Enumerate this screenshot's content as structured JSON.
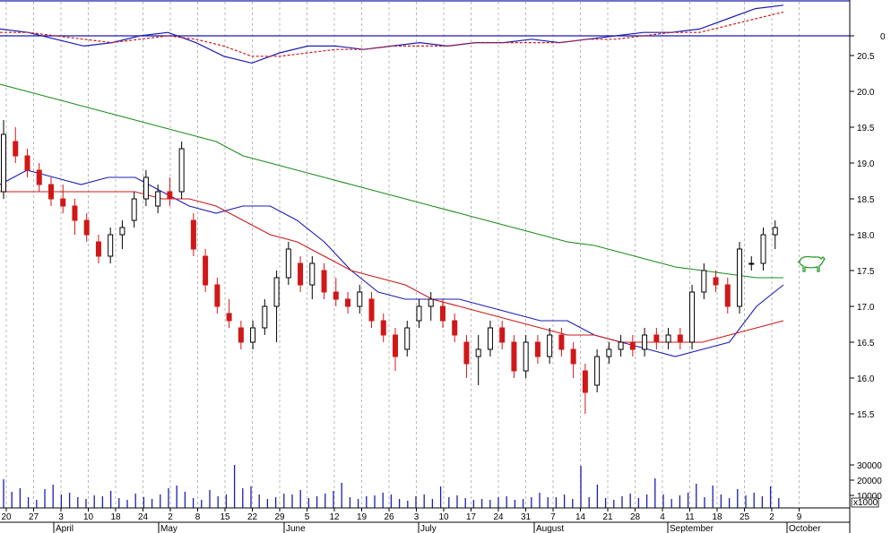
{
  "chart_data": {
    "type": "candlestick",
    "title": "",
    "price_axis": {
      "ticks": [
        "15.5",
        "16.0",
        "16.5",
        "17.0",
        "17.5",
        "18.0",
        "18.5",
        "19.0",
        "19.5",
        "20.0",
        "20.5"
      ],
      "ylim": [
        15.0,
        21.0
      ]
    },
    "oscillator_axis": {
      "ticks": [
        "0"
      ]
    },
    "volume_axis": {
      "ticks": [
        "30000",
        "20000",
        "10000"
      ],
      "unit_label": "x1000"
    },
    "x_ticks": [
      "20",
      "27",
      "3",
      "10",
      "18",
      "24",
      "2",
      "8",
      "15",
      "22",
      "29",
      "5",
      "12",
      "19",
      "26",
      "3",
      "10",
      "17",
      "24",
      "31",
      "7",
      "14",
      "21",
      "28",
      "4",
      "11",
      "18",
      "25",
      "2",
      "9"
    ],
    "months": [
      "April",
      "May",
      "June",
      "July",
      "August",
      "September",
      "October"
    ],
    "series": [
      {
        "name": "",
        "kind": "sma_short",
        "color": "#1c1cb4",
        "values": [
          18.7,
          18.9,
          18.8,
          18.7,
          18.8,
          18.8,
          18.6,
          18.4,
          18.3,
          18.4,
          18.4,
          18.2,
          17.9,
          17.5,
          17.2,
          17.1,
          17.1,
          17.1,
          17.0,
          16.9,
          16.8,
          16.8,
          16.6,
          16.5,
          16.4,
          16.3,
          16.4,
          16.5,
          17.0,
          17.3
        ]
      },
      {
        "name": "",
        "kind": "sma_medium",
        "color": "#cc1a1a",
        "values": [
          18.6,
          18.6,
          18.6,
          18.6,
          18.6,
          18.6,
          18.5,
          18.5,
          18.4,
          18.2,
          18.0,
          17.9,
          17.7,
          17.5,
          17.4,
          17.3,
          17.1,
          17.0,
          16.9,
          16.8,
          16.7,
          16.6,
          16.6,
          16.5,
          16.5,
          16.5,
          16.5,
          16.6,
          16.7,
          16.8
        ]
      },
      {
        "name": "",
        "kind": "sma_long",
        "color": "#1e8c1e",
        "values": [
          20.1,
          20.0,
          19.9,
          19.8,
          19.7,
          19.6,
          19.5,
          19.4,
          19.3,
          19.1,
          19.0,
          18.9,
          18.8,
          18.7,
          18.6,
          18.5,
          18.4,
          18.3,
          18.2,
          18.1,
          18.0,
          17.9,
          17.85,
          17.75,
          17.65,
          17.55,
          17.5,
          17.45,
          17.4,
          17.4
        ]
      }
    ],
    "oscillator_series": [
      {
        "name": "",
        "color": "#1c1cb4",
        "style": "solid",
        "values": [
          0.2,
          0.1,
          -0.1,
          -0.3,
          -0.2,
          0.0,
          0.1,
          -0.2,
          -0.6,
          -0.8,
          -0.5,
          -0.3,
          -0.3,
          -0.4,
          -0.3,
          -0.2,
          -0.3,
          -0.2,
          -0.2,
          -0.1,
          -0.2,
          -0.1,
          0.0,
          0.1,
          0.1,
          0.2,
          0.5,
          0.8,
          0.9
        ]
      },
      {
        "name": "",
        "color": "#cc1a1a",
        "style": "dashed",
        "values": [
          0.1,
          0.1,
          0.0,
          -0.1,
          -0.2,
          -0.1,
          0.0,
          -0.1,
          -0.3,
          -0.6,
          -0.6,
          -0.5,
          -0.4,
          -0.4,
          -0.3,
          -0.3,
          -0.3,
          -0.2,
          -0.2,
          -0.2,
          -0.2,
          -0.1,
          -0.1,
          0.0,
          0.1,
          0.1,
          0.3,
          0.5,
          0.7
        ]
      }
    ],
    "candles": [
      {
        "o": 18.6,
        "h": 19.6,
        "l": 18.5,
        "c": 19.4
      },
      {
        "o": 19.3,
        "h": 19.5,
        "l": 19.0,
        "c": 19.1
      },
      {
        "o": 19.1,
        "h": 19.2,
        "l": 18.8,
        "c": 18.9
      },
      {
        "o": 18.9,
        "h": 19.0,
        "l": 18.6,
        "c": 18.7
      },
      {
        "o": 18.7,
        "h": 18.8,
        "l": 18.4,
        "c": 18.5
      },
      {
        "o": 18.5,
        "h": 18.7,
        "l": 18.3,
        "c": 18.4
      },
      {
        "o": 18.4,
        "h": 18.5,
        "l": 18.0,
        "c": 18.2
      },
      {
        "o": 18.2,
        "h": 18.3,
        "l": 17.9,
        "c": 18.0
      },
      {
        "o": 17.9,
        "h": 18.0,
        "l": 17.6,
        "c": 17.7
      },
      {
        "o": 17.7,
        "h": 18.1,
        "l": 17.6,
        "c": 18.0
      },
      {
        "o": 18.0,
        "h": 18.2,
        "l": 17.8,
        "c": 18.1
      },
      {
        "o": 18.2,
        "h": 18.6,
        "l": 18.1,
        "c": 18.5
      },
      {
        "o": 18.5,
        "h": 18.9,
        "l": 18.4,
        "c": 18.8
      },
      {
        "o": 18.4,
        "h": 18.7,
        "l": 18.3,
        "c": 18.6
      },
      {
        "o": 18.6,
        "h": 18.8,
        "l": 18.4,
        "c": 18.5
      },
      {
        "o": 18.6,
        "h": 19.3,
        "l": 18.5,
        "c": 19.2
      },
      {
        "o": 18.2,
        "h": 18.3,
        "l": 17.7,
        "c": 17.8
      },
      {
        "o": 17.7,
        "h": 17.8,
        "l": 17.2,
        "c": 17.3
      },
      {
        "o": 17.3,
        "h": 17.4,
        "l": 16.9,
        "c": 17.0
      },
      {
        "o": 16.9,
        "h": 17.1,
        "l": 16.7,
        "c": 16.8
      },
      {
        "o": 16.7,
        "h": 16.8,
        "l": 16.4,
        "c": 16.5
      },
      {
        "o": 16.5,
        "h": 16.8,
        "l": 16.4,
        "c": 16.7
      },
      {
        "o": 16.7,
        "h": 17.1,
        "l": 16.6,
        "c": 17.0
      },
      {
        "o": 17.0,
        "h": 17.5,
        "l": 16.5,
        "c": 17.4
      },
      {
        "o": 17.4,
        "h": 17.9,
        "l": 17.3,
        "c": 17.8
      },
      {
        "o": 17.6,
        "h": 17.7,
        "l": 17.2,
        "c": 17.3
      },
      {
        "o": 17.3,
        "h": 17.7,
        "l": 17.1,
        "c": 17.6
      },
      {
        "o": 17.5,
        "h": 17.6,
        "l": 17.1,
        "c": 17.2
      },
      {
        "o": 17.2,
        "h": 17.4,
        "l": 17.0,
        "c": 17.1
      },
      {
        "o": 17.1,
        "h": 17.2,
        "l": 16.9,
        "c": 17.0
      },
      {
        "o": 17.0,
        "h": 17.3,
        "l": 16.9,
        "c": 17.2
      },
      {
        "o": 17.1,
        "h": 17.2,
        "l": 16.7,
        "c": 16.8
      },
      {
        "o": 16.8,
        "h": 16.9,
        "l": 16.5,
        "c": 16.6
      },
      {
        "o": 16.6,
        "h": 16.7,
        "l": 16.1,
        "c": 16.3
      },
      {
        "o": 16.4,
        "h": 16.8,
        "l": 16.3,
        "c": 16.7
      },
      {
        "o": 16.8,
        "h": 17.1,
        "l": 16.7,
        "c": 17.0
      },
      {
        "o": 17.0,
        "h": 17.2,
        "l": 16.8,
        "c": 17.1
      },
      {
        "o": 17.0,
        "h": 17.1,
        "l": 16.7,
        "c": 16.8
      },
      {
        "o": 16.8,
        "h": 16.9,
        "l": 16.5,
        "c": 16.6
      },
      {
        "o": 16.5,
        "h": 16.6,
        "l": 16.0,
        "c": 16.2
      },
      {
        "o": 16.3,
        "h": 16.6,
        "l": 15.9,
        "c": 16.4
      },
      {
        "o": 16.4,
        "h": 16.8,
        "l": 16.3,
        "c": 16.7
      },
      {
        "o": 16.7,
        "h": 16.8,
        "l": 16.4,
        "c": 16.5
      },
      {
        "o": 16.5,
        "h": 16.6,
        "l": 16.0,
        "c": 16.1
      },
      {
        "o": 16.1,
        "h": 16.6,
        "l": 16.0,
        "c": 16.5
      },
      {
        "o": 16.5,
        "h": 16.6,
        "l": 16.2,
        "c": 16.3
      },
      {
        "o": 16.3,
        "h": 16.7,
        "l": 16.2,
        "c": 16.6
      },
      {
        "o": 16.6,
        "h": 16.7,
        "l": 16.3,
        "c": 16.4
      },
      {
        "o": 16.4,
        "h": 16.5,
        "l": 16.0,
        "c": 16.2
      },
      {
        "o": 16.1,
        "h": 16.2,
        "l": 15.5,
        "c": 15.8
      },
      {
        "o": 15.9,
        "h": 16.4,
        "l": 15.8,
        "c": 16.3
      },
      {
        "o": 16.3,
        "h": 16.5,
        "l": 16.2,
        "c": 16.4
      },
      {
        "o": 16.4,
        "h": 16.6,
        "l": 16.3,
        "c": 16.5
      },
      {
        "o": 16.5,
        "h": 16.6,
        "l": 16.3,
        "c": 16.4
      },
      {
        "o": 16.4,
        "h": 16.7,
        "l": 16.3,
        "c": 16.6
      },
      {
        "o": 16.6,
        "h": 16.7,
        "l": 16.4,
        "c": 16.5
      },
      {
        "o": 16.5,
        "h": 16.7,
        "l": 16.4,
        "c": 16.6
      },
      {
        "o": 16.6,
        "h": 16.7,
        "l": 16.4,
        "c": 16.5
      },
      {
        "o": 16.5,
        "h": 17.3,
        "l": 16.4,
        "c": 17.2
      },
      {
        "o": 17.2,
        "h": 17.6,
        "l": 17.1,
        "c": 17.5
      },
      {
        "o": 17.4,
        "h": 17.5,
        "l": 17.2,
        "c": 17.3
      },
      {
        "o": 17.3,
        "h": 17.4,
        "l": 16.9,
        "c": 17.0
      },
      {
        "o": 17.0,
        "h": 17.9,
        "l": 16.9,
        "c": 17.8
      },
      {
        "o": 17.6,
        "h": 17.7,
        "l": 17.5,
        "c": 17.6
      },
      {
        "o": 17.6,
        "h": 18.1,
        "l": 17.5,
        "c": 18.0
      },
      {
        "o": 18.0,
        "h": 18.2,
        "l": 17.8,
        "c": 18.1
      }
    ],
    "volumes": [
      3200,
      1800,
      2200,
      1200,
      900,
      2100,
      2600,
      1500,
      1700,
      1200,
      1000,
      1400,
      1300,
      1900,
      1100,
      900,
      1600,
      1200,
      1000,
      1500,
      2200,
      2500,
      1800,
      1100,
      900,
      2000,
      1300,
      1500,
      4800,
      2200,
      2400,
      1500,
      1000,
      1200,
      1600,
      1500,
      2000,
      1100,
      1300,
      1600,
      1900,
      2800,
      1200,
      1000,
      1300,
      1400,
      1700,
      1500,
      1000,
      800,
      1300,
      1500,
      1000,
      2400,
      1200,
      1400,
      1100,
      900,
      1000,
      900,
      1200,
      1300,
      900,
      1000,
      1200,
      1700,
      1200,
      1200,
      1500,
      1000,
      4700,
      1200,
      2600,
      1100,
      900,
      1300,
      1600,
      1100,
      1500,
      3300,
      1500,
      1000,
      1400,
      1700,
      2700,
      1200,
      2500,
      1500,
      1100,
      2100,
      1400,
      1700,
      1300,
      2400,
      1100
    ]
  }
}
